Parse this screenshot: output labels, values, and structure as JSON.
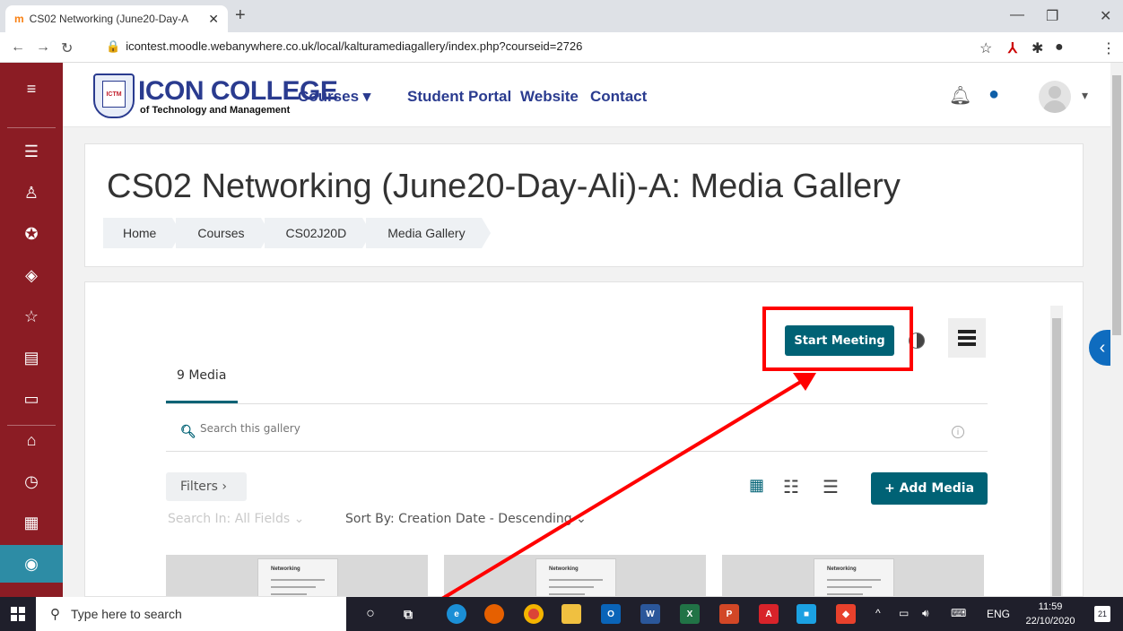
{
  "browser": {
    "tab_title": "CS02 Networking (June20-Day-A",
    "tab_favicon": "m",
    "url": "icontest.moodle.webanywhere.co.uk/local/kalturamediagallery/index.php?courseid=2726"
  },
  "header": {
    "logo_title": "ICON COLLEGE",
    "logo_subtitle": "of Technology and Management",
    "nav": [
      "Courses",
      "Student Portal",
      "Website",
      "Contact"
    ]
  },
  "page": {
    "title": "CS02 Networking (June20-Day-Ali)-A: Media Gallery",
    "breadcrumb": [
      "Home",
      "Courses",
      "CS02J20D",
      "Media Gallery"
    ]
  },
  "gallery": {
    "start_meeting": "Start Meeting",
    "media_count": "9 Media",
    "search_placeholder": "Search this gallery",
    "filters": "Filters ›",
    "search_in": "Search In: All Fields ⌄",
    "sort_by": "Sort By: Creation Date - Descending ⌄",
    "add_media": "+ Add Media",
    "thumb_label": "Networking"
  },
  "taskbar": {
    "search_placeholder": "Type here to search",
    "lang": "ENG",
    "time": "11:59",
    "date": "22/10/2020",
    "notifications": "21"
  },
  "colors": {
    "sidebar": "#8b1c24",
    "accent": "#006275",
    "brand_blue": "#2a3b8f",
    "annotation": "#ff0000"
  }
}
